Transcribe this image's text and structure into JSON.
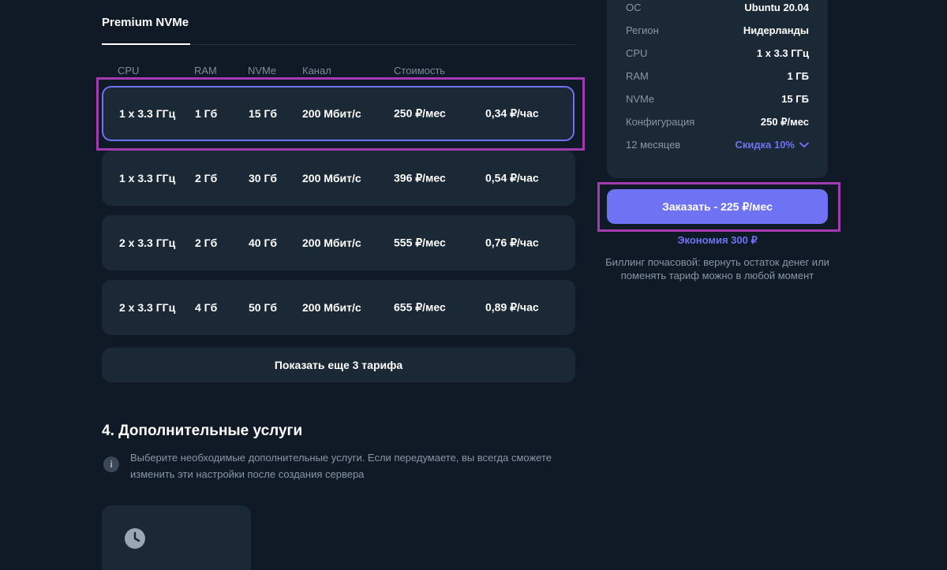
{
  "tabs": {
    "active": "Premium NVMe"
  },
  "table": {
    "headers": {
      "cpu": "CPU",
      "ram": "RAM",
      "nvme": "NVMe",
      "channel": "Канал",
      "cost": "Стоимость"
    },
    "rows": [
      {
        "cpu": "1 x 3.3 ГГц",
        "ram": "1 Гб",
        "nvme": "15 Гб",
        "channel": "200 Мбит/с",
        "monthly": "250 ₽/мес",
        "hourly": "0,34 ₽/час"
      },
      {
        "cpu": "1 x 3.3 ГГц",
        "ram": "2 Гб",
        "nvme": "30 Гб",
        "channel": "200 Мбит/с",
        "monthly": "396 ₽/мес",
        "hourly": "0,54 ₽/час"
      },
      {
        "cpu": "2 x 3.3 ГГц",
        "ram": "2 Гб",
        "nvme": "40 Гб",
        "channel": "200 Мбит/с",
        "monthly": "555 ₽/мес",
        "hourly": "0,76 ₽/час"
      },
      {
        "cpu": "2 x 3.3 ГГц",
        "ram": "4 Гб",
        "nvme": "50 Гб",
        "channel": "200 Мбит/с",
        "monthly": "655 ₽/мес",
        "hourly": "0,89 ₽/час"
      }
    ],
    "show_more": "Показать еще 3 тарифа"
  },
  "services": {
    "title": "4. Дополнительные услуги",
    "info": "Выберите необходимые дополнительные услуги. Если передумаете, вы всегда сможете изменить эти настройки после создания сервера",
    "info_icon": "info-icon",
    "card_icon": "clock-icon"
  },
  "summary": {
    "rows": [
      {
        "label": "ОС",
        "value": "Ubuntu 20.04"
      },
      {
        "label": "Регион",
        "value": "Нидерланды"
      },
      {
        "label": "CPU",
        "value": "1 x 3.3 ГГц"
      },
      {
        "label": "RAM",
        "value": "1 ГБ"
      },
      {
        "label": "NVMe",
        "value": "15 ГБ"
      },
      {
        "label": "Конфигурация",
        "value": "250 ₽/мес"
      }
    ],
    "period_label": "12 месяцев",
    "discount": "Скидка 10%",
    "order_button": "Заказать - 225 ₽/мес",
    "savings": "Экономия 300 ₽",
    "billing": "Биллинг почасовой: вернуть остаток денег или поменять тариф можно в любой момент"
  },
  "colors": {
    "background": "#0f1a26",
    "card": "#1b2836",
    "accent": "#6f72f3",
    "highlight": "#a23bb0"
  }
}
